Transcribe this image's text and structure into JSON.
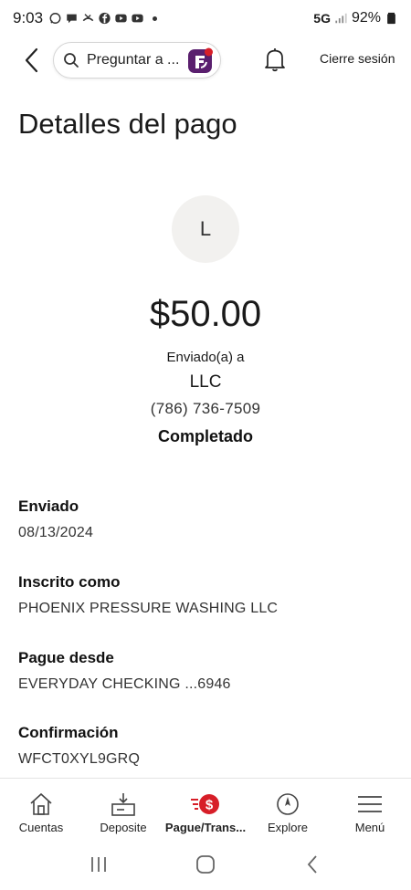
{
  "status_bar": {
    "time": "9:03",
    "network": "5G",
    "battery": "92%"
  },
  "header": {
    "search_placeholder": "Preguntar a ...",
    "sign_off": "Cierre sesión"
  },
  "page": {
    "title": "Detalles del pago"
  },
  "payment": {
    "avatar_initial": "L",
    "amount": "$50.00",
    "sent_to_label": "Enviado(a) a",
    "recipient": "LLC",
    "phone": "(786) 736-7509",
    "status": "Completado"
  },
  "details": [
    {
      "label": "Enviado",
      "value": "08/13/2024"
    },
    {
      "label": "Inscrito como",
      "value": "PHOENIX PRESSURE WASHING LLC"
    },
    {
      "label": "Pague desde",
      "value": "EVERYDAY CHECKING ...6946"
    },
    {
      "label": "Confirmación",
      "value": "WFCT0XYL9GRQ"
    }
  ],
  "bottom_nav": [
    {
      "label": "Cuentas",
      "icon": "home-icon",
      "active": false
    },
    {
      "label": "Deposite",
      "icon": "deposit-icon",
      "active": false
    },
    {
      "label": "Pague/Trans...",
      "icon": "pay-transfer-icon",
      "active": true
    },
    {
      "label": "Explore",
      "icon": "compass-icon",
      "active": false
    },
    {
      "label": "Menú",
      "icon": "hamburger-menu-icon",
      "active": false
    }
  ],
  "colors": {
    "accent_red": "#d71e28",
    "fargo_purple": "#5a1f6e",
    "avatar_bg": "#f2f1ef"
  }
}
